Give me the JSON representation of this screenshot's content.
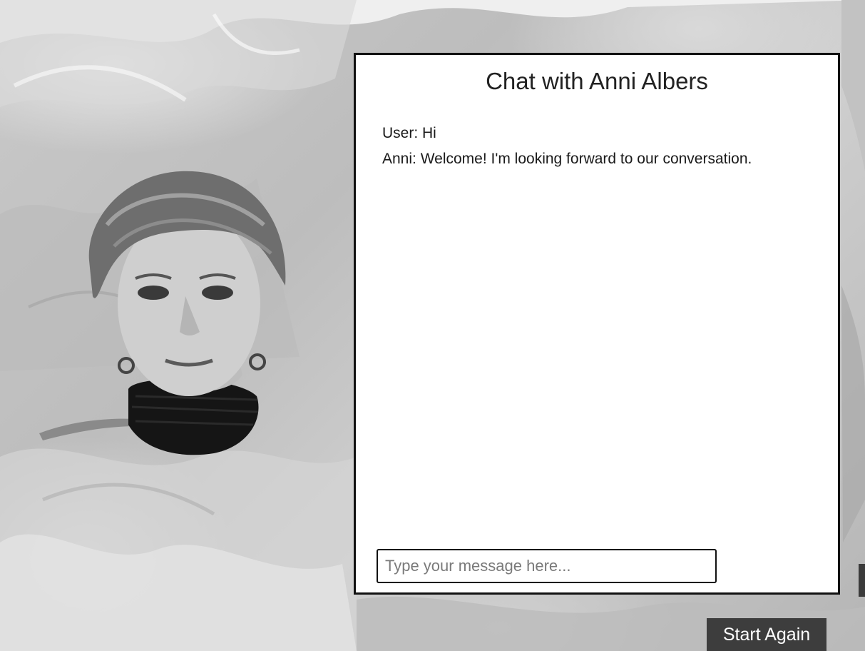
{
  "chat": {
    "title": "Chat with Anni Albers",
    "messages": [
      {
        "text": "User: Hi"
      },
      {
        "text": "Anni: Welcome! I'm looking forward to our conversation."
      }
    ],
    "input_placeholder": "Type your message here...",
    "input_value": ""
  },
  "controls": {
    "start_again_label": "Start Again"
  },
  "colors": {
    "panel_border": "#111111",
    "button_bg": "#3d3d3d",
    "button_text": "#ffffff"
  }
}
